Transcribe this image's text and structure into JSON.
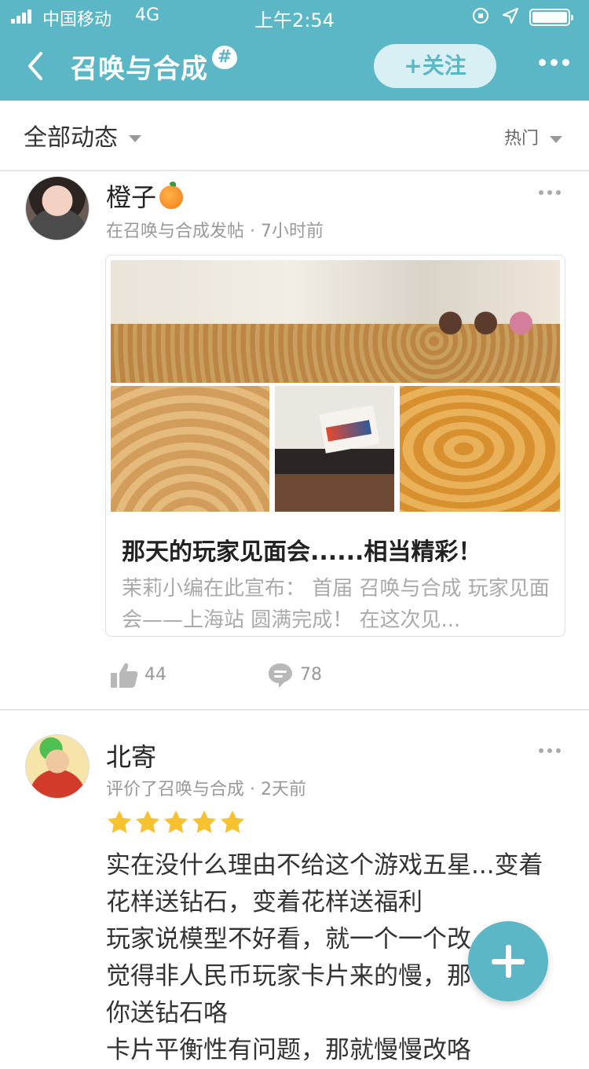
{
  "status_bar": {
    "carrier": "中国移动",
    "network": "4G",
    "time": "上午2:54"
  },
  "nav": {
    "title": "召唤与合成",
    "badge": "#",
    "follow_label": "+关注"
  },
  "filter": {
    "left_label": "全部动态",
    "right_label": "热门"
  },
  "posts": [
    {
      "username": "橙子",
      "meta": "在召唤与合成发帖 · 7小时前",
      "card": {
        "title": "那天的玩家见面会......相当精彩！",
        "excerpt": "茉莉小编在此宣布：  首届 召唤与合成 玩家见面会——上海站 圆满完成！   在这次见..."
      },
      "likes": "44",
      "comments": "78"
    },
    {
      "username": "北寄",
      "meta": "评价了召唤与合成 · 2天前",
      "rating": 5,
      "review_lines": [
        "实在没什么理由不给这个游戏五星...变着",
        "花样送钻石，变着花样送福利",
        "玩家说模型不好看，就一个一个改",
        "觉得非人民币玩家卡片来的慢，那",
        "你送钻石咯",
        "卡片平衡性有问题，那就慢慢改咯"
      ]
    }
  ],
  "colors": {
    "accent": "#5bb7c6",
    "star": "#f7c12f"
  }
}
